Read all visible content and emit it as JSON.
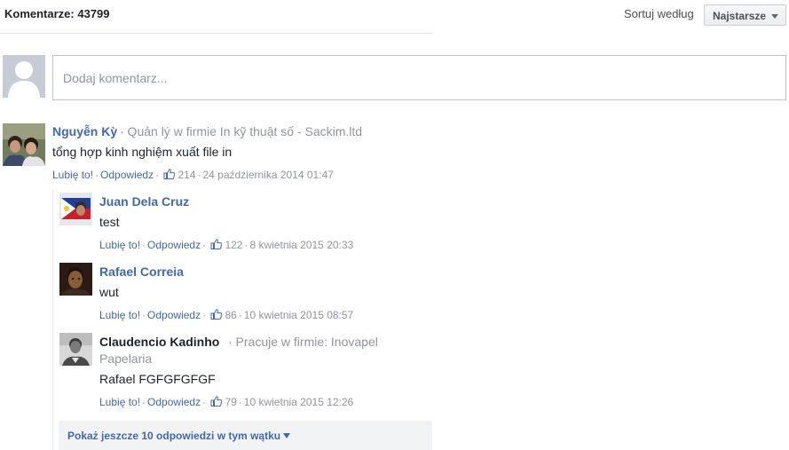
{
  "header": {
    "comment_count": "Komentarze: 43799",
    "sort_label": "Sortuj według",
    "sort_value": "Najstarsze"
  },
  "composer": {
    "placeholder": "Dodaj komentarz..."
  },
  "actions": {
    "like": "Lubię to!",
    "reply": "Odpowiedz"
  },
  "comments": [
    {
      "author": "Nguyễn Kỳ",
      "byline": "· Quản lý w firmie In kỹ thuật số - Sackim.ltd",
      "text": "tổng hợp kinh nghiệm xuất file in",
      "likes": "214",
      "timestamp": "24 października 2014 01:47"
    }
  ],
  "replies": [
    {
      "author": "Juan Dela Cruz",
      "text": "test",
      "likes": "122",
      "timestamp": "8 kwietnia 2015 20:33"
    },
    {
      "author": "Rafael Correia",
      "text": "wut",
      "likes": "86",
      "timestamp": "10 kwietnia 2015 08:57"
    },
    {
      "author": "Claudencio Kadinho",
      "byline_1": "· Pracuje w firmie: Inovapel",
      "byline_2": "Papelaria",
      "text": "Rafael FGFGFGFGF",
      "likes": "79",
      "timestamp": "10 kwietnia 2015 12:26"
    }
  ],
  "more_replies": "Pokaż jeszcze 10 odpowiedzi w tym wątku",
  "colors": {
    "link": "#4267b2",
    "meta": "#90949c",
    "text": "#1d2129"
  }
}
